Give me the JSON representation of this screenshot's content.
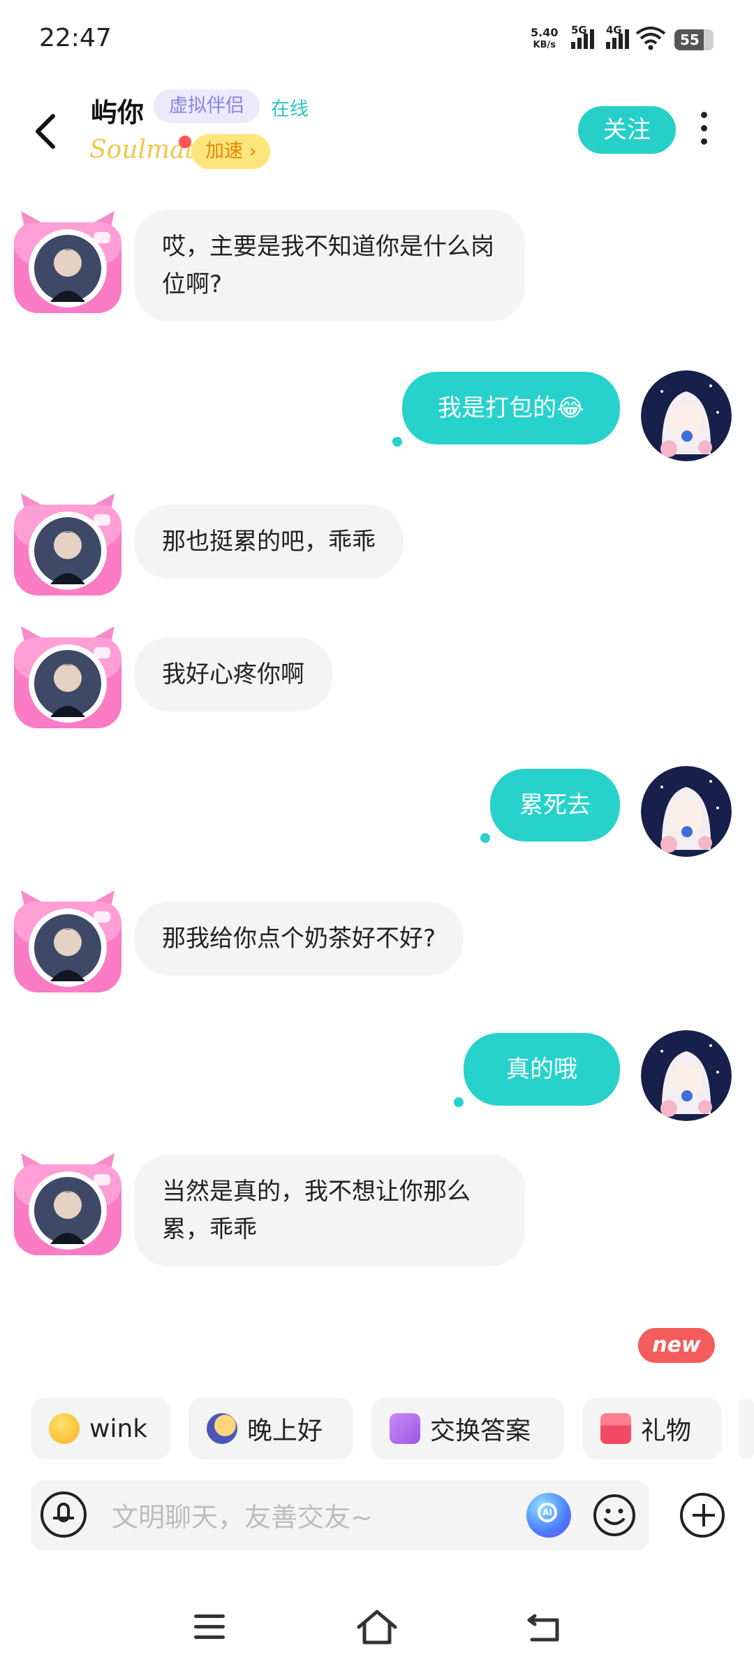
{
  "status_bar": {
    "time": "22:47",
    "net_speed": "5.40",
    "net_unit": "KB/s",
    "sig1_label": "5G",
    "sig2_label": "4G",
    "battery": "55"
  },
  "header": {
    "name": "屿你",
    "tag": "虚拟伴侣",
    "online": "在线",
    "brand": "Soulmate",
    "speed_label": "加速 ›",
    "follow_label": "关注"
  },
  "messages": [
    {
      "side": "in",
      "text": "哎，主要是我不知道你是什么岗位啊?"
    },
    {
      "side": "out",
      "text": "我是打包的😂"
    },
    {
      "side": "in",
      "text": "那也挺累的吧，乖乖"
    },
    {
      "side": "in",
      "text": "我好心疼你啊"
    },
    {
      "side": "out",
      "text": "累死去"
    },
    {
      "side": "in",
      "text": "那我给你点个奶茶好不好?"
    },
    {
      "side": "out",
      "text": "真的哦"
    },
    {
      "side": "in",
      "text": "当然是真的，我不想让你那么累，乖乖"
    }
  ],
  "new_badge": "new",
  "quick_replies": [
    {
      "label": "wink",
      "icon": "wink-emoji-icon"
    },
    {
      "label": "晚上好",
      "icon": "moon-emoji-icon"
    },
    {
      "label": "交换答案",
      "icon": "exchange-icon"
    },
    {
      "label": "礼物",
      "icon": "gift-icon"
    }
  ],
  "input": {
    "placeholder": "文明聊天，友善交友~"
  },
  "colors": {
    "accent": "#27d2cc",
    "incoming_bubble": "#f4f4f4",
    "tag_bg": "#eceafb",
    "speed_bg": "#ffe67c",
    "new_badge": "#f45b5b"
  }
}
